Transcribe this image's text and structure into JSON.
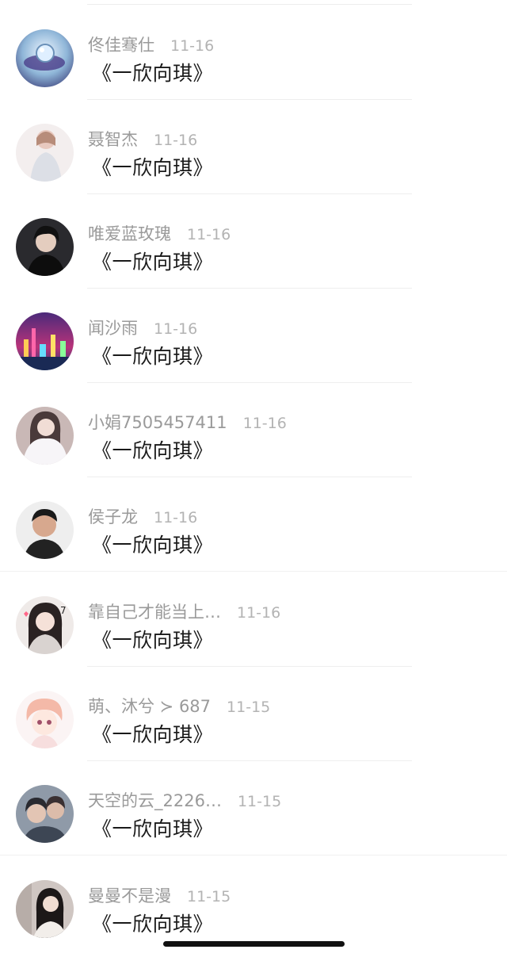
{
  "comments": [
    {
      "username": "佟佳骞仕",
      "date": "11-16",
      "content": "《一欣向琪》",
      "avatar": "water-drop-avatar",
      "full_divider": false
    },
    {
      "username": "聂智杰",
      "date": "11-16",
      "content": "《一欣向琪》",
      "avatar": "girl-light-avatar",
      "full_divider": false
    },
    {
      "username": "唯爱蓝玫瑰",
      "date": "11-16",
      "content": "《一欣向琪》",
      "avatar": "man-dark-avatar",
      "full_divider": false
    },
    {
      "username": "闻沙雨",
      "date": "11-16",
      "content": "《一欣向琪》",
      "avatar": "city-night-avatar",
      "full_divider": false
    },
    {
      "username": "小娟7505457411",
      "date": "11-16",
      "content": "《一欣向琪》",
      "avatar": "girl-fur-avatar",
      "full_divider": false
    },
    {
      "username": "侯子龙",
      "date": "11-16",
      "content": "《一欣向琪》",
      "avatar": "man-portrait-avatar",
      "full_divider": true
    },
    {
      "username": "靠自己才能当上…",
      "date": "11-16",
      "content": "《一欣向琪》",
      "avatar": "girl-hearts-avatar",
      "full_divider": false
    },
    {
      "username": "萌、沐兮 ≻ 687",
      "date": "11-15",
      "content": "《一欣向琪》",
      "avatar": "anime-girl-avatar",
      "full_divider": false
    },
    {
      "username": "天空的云_2226…",
      "date": "11-15",
      "content": "《一欣向琪》",
      "avatar": "couple-avatar",
      "full_divider": true
    },
    {
      "username": "曼曼不是漫",
      "date": "11-15",
      "content": "《一欣向琪》",
      "avatar": "girl-mirror-avatar",
      "full_divider": false
    }
  ],
  "colors": {
    "username": "#9a9a9a",
    "date": "#b3b3b3",
    "content": "#1a1a1a",
    "divider": "#eeeeee"
  }
}
